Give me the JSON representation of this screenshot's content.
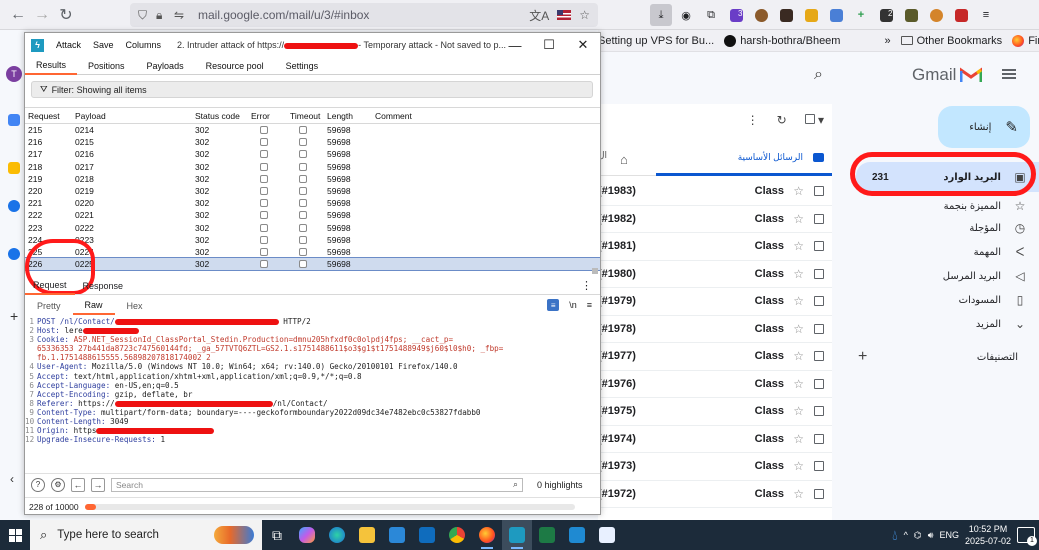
{
  "browser": {
    "url": "mail.google.com/mail/u/3/#inbox",
    "bookmarks": [
      {
        "label": "Setting up VPS for Bu...",
        "icon": "page-icon"
      },
      {
        "label": "harsh-bothra/Bheem",
        "icon": "github-icon"
      }
    ],
    "bookmarks_overflow": "»",
    "other_bookmarks": "Other Bookmarks",
    "finish_setup": "Finish setup",
    "ext_badges": [
      "3",
      "2"
    ]
  },
  "gmail": {
    "logo_text": "Gmail",
    "compose_label": "إنشاء",
    "nav": [
      {
        "label": "البريد الوارد",
        "count": "231",
        "icon": "inbox-icon",
        "active": true
      },
      {
        "label": "المميزة بنجمة",
        "icon": "star-icon"
      },
      {
        "label": "المؤجلة",
        "icon": "clock-icon"
      },
      {
        "label": "المهمة",
        "icon": "label-important-icon"
      },
      {
        "label": "البريد المرسل",
        "icon": "send-icon"
      },
      {
        "label": "المسودات",
        "icon": "draft-icon"
      },
      {
        "label": "المزيد",
        "icon": "chevron-down-icon"
      }
    ],
    "labels_title": "التصنيفات",
    "primary_tab": "الرسائل الأساسية",
    "tab_fragment": "ال",
    "rows": [
      {
        "subject": "(#1983)",
        "sender": "Class"
      },
      {
        "subject": "(#1982)",
        "sender": "Class"
      },
      {
        "subject": "(#1981)",
        "sender": "Class"
      },
      {
        "subject": "(#1980)",
        "sender": "Class"
      },
      {
        "subject": "(#1979)",
        "sender": "Class"
      },
      {
        "subject": "(#1978)",
        "sender": "Class"
      },
      {
        "subject": "(#1977)",
        "sender": "Class"
      },
      {
        "subject": "(#1976)",
        "sender": "Class"
      },
      {
        "subject": "(#1975)",
        "sender": "Class"
      },
      {
        "subject": "(#1974)",
        "sender": "Class"
      },
      {
        "subject": "(#1973)",
        "sender": "Class"
      },
      {
        "subject": "(#1972)",
        "sender": "Class"
      }
    ]
  },
  "burp": {
    "menu": [
      "Attack",
      "Save",
      "Columns"
    ],
    "title_prefix": "2. Intruder attack of https://",
    "title_suffix": "- Temporary attack - Not saved to p...",
    "tabs": [
      "Results",
      "Positions",
      "Payloads",
      "Resource pool",
      "Settings"
    ],
    "filter_text": "Filter: Showing all items",
    "columns": [
      "Request",
      "Payload",
      "Status code",
      "Error",
      "Timeout",
      "Length",
      "Comment"
    ],
    "rows": [
      {
        "req": "215",
        "payload": "0214",
        "status": "302",
        "length": "59698"
      },
      {
        "req": "216",
        "payload": "0215",
        "status": "302",
        "length": "59698"
      },
      {
        "req": "217",
        "payload": "0216",
        "status": "302",
        "length": "59698"
      },
      {
        "req": "218",
        "payload": "0217",
        "status": "302",
        "length": "59698"
      },
      {
        "req": "219",
        "payload": "0218",
        "status": "302",
        "length": "59698"
      },
      {
        "req": "220",
        "payload": "0219",
        "status": "302",
        "length": "59698"
      },
      {
        "req": "221",
        "payload": "0220",
        "status": "302",
        "length": "59698"
      },
      {
        "req": "222",
        "payload": "0221",
        "status": "302",
        "length": "59698"
      },
      {
        "req": "223",
        "payload": "0222",
        "status": "302",
        "length": "59698"
      },
      {
        "req": "224",
        "payload": "0223",
        "status": "302",
        "length": "59698"
      },
      {
        "req": "225",
        "payload": "0224",
        "status": "302",
        "length": "59698"
      },
      {
        "req": "226",
        "payload": "0225",
        "status": "302",
        "length": "59698",
        "selected": true
      }
    ],
    "req_tabs": [
      "Request",
      "Response"
    ],
    "view_tabs": [
      "Pretty",
      "Raw",
      "Hex"
    ],
    "newline_toggle": "\\n",
    "raw_lines": [
      {
        "n": "1",
        "name": "POST /nl/Contact/",
        "val": "",
        "tail": " HTTP/2"
      },
      {
        "n": "2",
        "name": "Host: ",
        "val": "lere"
      },
      {
        "n": "3",
        "name": "Cookie: ",
        "val": "ASP.NET_SessionId_ClassPortal_Stedin.Production=dmnu205hfxdf0c0olpdj4fps; __cact_p="
      },
      {
        "n": "",
        "name": "",
        "val": "65336353 27b441da8723c747560144fd; _ga_57TVTQ6ZTL=GS2.1.s1751488611$o3$g1$t1751488949$j60$l0$h0; _fbp="
      },
      {
        "n": "",
        "name": "",
        "val": "fb.1.1751488615555.56898207818174002 2"
      },
      {
        "n": "4",
        "name": "User-Agent: ",
        "val": "Mozilla/5.0 (Windows NT 10.0; Win64; x64; rv:140.0) Gecko/20100101 Firefox/140.0"
      },
      {
        "n": "5",
        "name": "Accept: ",
        "val": "text/html,application/xhtml+xml,application/xml;q=0.9,*/*;q=0.8"
      },
      {
        "n": "6",
        "name": "Accept-Language: ",
        "val": "en-US,en;q=0.5"
      },
      {
        "n": "7",
        "name": "Accept-Encoding: ",
        "val": "gzip, deflate, br"
      },
      {
        "n": "8",
        "name": "Referer: ",
        "val": "https://",
        "tail": "/nl/Contact/"
      },
      {
        "n": "9",
        "name": "Content-Type: ",
        "val": "multipart/form-data; boundary=----geckoformboundary2022d09dc34e7482ebc0c53827fdabb0"
      },
      {
        "n": "10",
        "name": "Content-Length: ",
        "val": "3049"
      },
      {
        "n": "11",
        "name": "Origin: ",
        "val": "https"
      },
      {
        "n": "12",
        "name": "Upgrade-Insecure-Requests: ",
        "val": "1"
      }
    ],
    "search_placeholder": "Search",
    "highlights": "0 highlights",
    "status_text": "228 of 10000",
    "progress": 0.023
  },
  "taskbar": {
    "search_placeholder": "Type here to search",
    "lang": "ENG",
    "time": "10:52 PM",
    "date": "2025-07-02",
    "notif_count": "1"
  }
}
